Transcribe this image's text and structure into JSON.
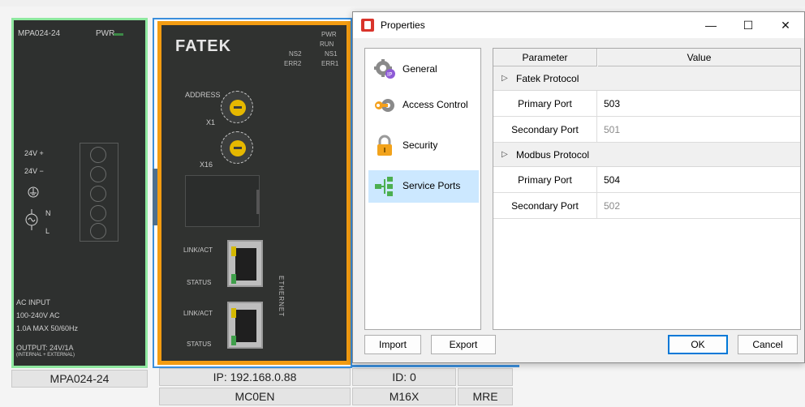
{
  "hardware": {
    "psu": {
      "model": "MPA024-24",
      "pwr_label": "PWR",
      "term_24v_plus": "24V +",
      "term_24v_minus": "24V −",
      "term_n": "N",
      "term_l": "L",
      "spec_ac_input": "AC INPUT",
      "spec_voltage": "100-240V AC",
      "spec_current": "1.0A MAX 50/60Hz",
      "spec_output": "OUTPUT: 24V/1A",
      "spec_output_sub": "(INTERNAL + EXTERNAL)"
    },
    "cpu": {
      "brand": "FATEK",
      "led_pwr": "PWR",
      "led_run": "RUN",
      "led_ns2": "NS2",
      "led_ns1": "NS1",
      "led_err2": "ERR2",
      "led_err1": "ERR1",
      "address_label": "ADDRESS",
      "x1_label": "X1",
      "x16_label": "X16",
      "link_act_1": "LINK/ACT",
      "status_1": "STATUS",
      "link_act_2": "LINK/ACT",
      "status_2": "STATUS",
      "ethernet_label": "ETHERNET"
    },
    "labels": {
      "psu_name": "MPA024-24",
      "ip": "IP: 192.168.0.88",
      "id": "ID: 0",
      "cpu_model": "MC0EN",
      "io_model": "M16X",
      "mre": "MRE"
    }
  },
  "dialog": {
    "title": "Properties",
    "minimize": "—",
    "maximize": "☐",
    "close": "✕",
    "categories": [
      {
        "label": "General",
        "icon": "gear-ip-icon"
      },
      {
        "label": "Access Control",
        "icon": "key-gear-icon"
      },
      {
        "label": "Security",
        "icon": "padlock-icon"
      },
      {
        "label": "Service Ports",
        "icon": "network-tree-icon"
      }
    ],
    "selected_category": "Service Ports",
    "grid": {
      "col_parameter": "Parameter",
      "col_value": "Value",
      "groups": [
        {
          "name": "Fatek Protocol",
          "rows": [
            {
              "param": "Primary Port",
              "value": "503"
            },
            {
              "param": "Secondary Port",
              "value": "501"
            }
          ]
        },
        {
          "name": "Modbus Protocol",
          "rows": [
            {
              "param": "Primary Port",
              "value": "504"
            },
            {
              "param": "Secondary Port",
              "value": "502"
            }
          ]
        }
      ]
    },
    "buttons": {
      "import": "Import",
      "export": "Export",
      "ok": "OK",
      "cancel": "Cancel"
    },
    "colors": {
      "selection": "#cce8ff",
      "default_button_border": "#0078d7",
      "disabled_value": "#8a8a8a"
    }
  }
}
